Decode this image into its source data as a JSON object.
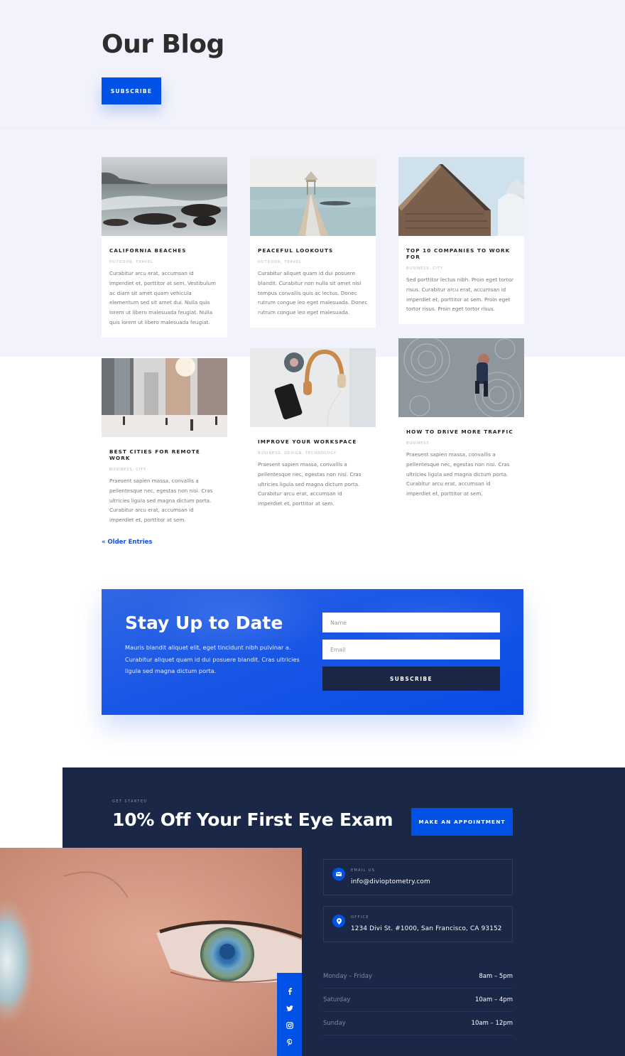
{
  "hero": {
    "title": "Our Blog",
    "subscribe_label": "SUBSCRIBE"
  },
  "posts": [
    {
      "title": "CALIFORNIA BEACHES",
      "categories": "OUTDOOR, TRAVEL",
      "excerpt": "Curabitur arcu erat, accumsan id imperdiet et, porttitor at sem. Vestibulum ac diam sit amet quam vehicula elementum sed sit amet dui. Nulla quis lorem ut libero malesuada feugiat. Nulla quis lorem ut libero malesuada feugiat.",
      "image": "rocky-sea-shore-photo"
    },
    {
      "title": "PEACEFUL LOOKOUTS",
      "categories": "OUTDOOR, TRAVEL",
      "excerpt": "Curabitur aliquet quam id dui posuere blandit. Curabitur non nulla sit amet nisl tempus convallis quis ac lectus. Donec rutrum congue leo eget malesuada. Donec rutrum congue leo eget malesuada.",
      "image": "pier-gazebo-photo"
    },
    {
      "title": "TOP 10 COMPANIES TO WORK FOR",
      "categories": "BUSINESS, CITY",
      "excerpt": "Sed porttitor lectus nibh. Proin eget tortor risus. Curabitur arcu erat, accumsan id imperdiet et, porttitor at sem. Proin eget tortor risus. Proin eget tortor risus.",
      "image": "building-corner-photo"
    },
    {
      "title": "BEST CITIES FOR REMOTE WORK",
      "categories": "BUSINESS, CITY",
      "excerpt": "Praesent sapien massa, convallis a pellentesque nec, egestas non nisi. Cras ultricies ligula sed magna dictum porta. Curabitur arcu erat, accumsan id imperdiet et, porttitor at sem.",
      "image": "city-street-photo"
    },
    {
      "title": "IMPROVE YOUR WORKSPACE",
      "categories": "BUSINESS, DESIGN, TECHNOLOGY",
      "excerpt": "Praesent sapien massa, convallis a pellentesque nec, egestas non nisi. Cras ultricies ligula sed magna dictum porta. Curabitur arcu erat, accumsan id imperdiet et, porttitor at sem.",
      "image": "headphones-desk-photo"
    },
    {
      "title": "HOW TO DRIVE MORE TRAFFIC",
      "categories": "BUSINESS",
      "excerpt": "Praesent sapien massa, convallis a pellentesque nec, egestas non nisi. Cras ultricies ligula sed magna dictum porta. Curabitur arcu erat, accumsan id imperdiet et, porttitor at sem.",
      "image": "person-walking-pavement-photo"
    }
  ],
  "pagination": {
    "older_entries": "« Older Entries"
  },
  "newsletter": {
    "title": "Stay Up to Date",
    "text": "Mauris blandit aliquet elit, eget tincidunt nibh pulvinar a. Curabitur aliquet quam id dui posuere blandit. Cras ultricies ligula sed magna dictum porta.",
    "name_placeholder": "Name",
    "email_placeholder": "Email",
    "subscribe_label": "SUBSCRIBE"
  },
  "cta": {
    "eyebrow": "GET STARTED",
    "title": "10% Off Your First Eye Exam",
    "button_label": "MAKE AN APPOINTMENT"
  },
  "contact": {
    "email_label": "EMAIL US",
    "email_value": "info@divioptometry.com",
    "office_label": "OFFICE",
    "office_value": "1234 Divi St. #1000, San Francisco, CA 93152"
  },
  "hours": [
    {
      "day": "Monday – Friday",
      "time": "8am – 5pm"
    },
    {
      "day": "Saturday",
      "time": "10am – 4pm"
    },
    {
      "day": "Sunday",
      "time": "10am – 12pm"
    }
  ],
  "social": [
    "facebook",
    "twitter",
    "instagram",
    "pinterest"
  ],
  "colors": {
    "accent": "#0051e6",
    "navy": "#1a2747",
    "hero_bg": "#f1f2fb"
  }
}
